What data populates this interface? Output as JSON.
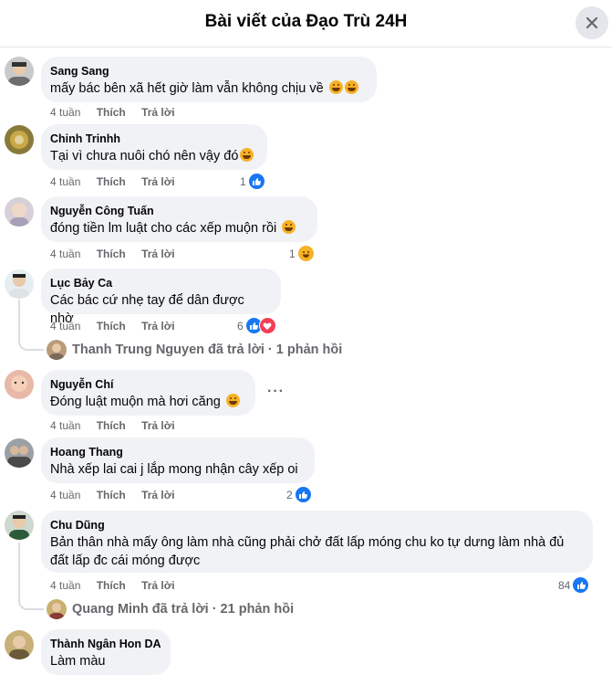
{
  "header": {
    "title": "Bài viết của Đạo Trù 24H"
  },
  "actions": {
    "like": "Thích",
    "reply": "Trả lời"
  },
  "comments": [
    {
      "name": "Sang Sang",
      "text": "mấy bác bên xã hết giờ làm vẫn không chịu về",
      "emoji_suffix": "laughing-emoji laughing-emoji",
      "time": "4 tuần"
    },
    {
      "name": "Chinh Trinhh",
      "text": "Tại vì chưa nuôi chó nên vậy đó",
      "emoji_suffix": "laughing-emoji",
      "time": "4 tuần",
      "reaction_count": "1",
      "reactions": [
        "like"
      ]
    },
    {
      "name": "Nguyễn Công Tuấn",
      "text": "đóng tiền lm luật cho các xếp muộn rồi",
      "emoji_suffix": "grin-emoji",
      "time": "4 tuần",
      "reaction_count": "1",
      "reactions": [
        "haha"
      ]
    },
    {
      "name": "Lục Bảy Ca",
      "text": "Các bác cứ nhẹ tay để dân được nhờ",
      "time": "4 tuần",
      "reaction_count": "6",
      "reactions": [
        "like",
        "love"
      ],
      "reply_summary": "Thanh Trung Nguyen đã trả lời · 1 phản hồi"
    },
    {
      "name": "Nguyễn Chí",
      "text": "Đóng luật muộn mà hơi căng",
      "emoji_suffix": "laughing-emoji",
      "time": "4 tuần",
      "more": "···"
    },
    {
      "name": "Hoang Thang",
      "text": "Nhà xếp lai cai j lắp mong nhận cây xếp oi",
      "time": "4 tuần",
      "reaction_count": "2",
      "reactions": [
        "like"
      ]
    },
    {
      "name": "Chu Dũng",
      "text_lines": [
        "Bản thân nhà mấy ông làm nhà cũng phải chở đất lấp móng chu ko tự dưng làm nhà đủ",
        "đất lấp đc cái móng được"
      ],
      "time": "4 tuần",
      "reaction_count": "84",
      "reactions": [
        "like"
      ],
      "reply_summary": "Quang Minh đã trả lời · 21 phản hồi"
    },
    {
      "name": "Thành Ngân Hon DA",
      "text": "Làm màu"
    }
  ],
  "colors": {
    "like_blue": "#1877f2",
    "love_red": "#f33e58",
    "haha_yellow": "#f7b125",
    "bubble_bg": "#f0f2f5"
  }
}
